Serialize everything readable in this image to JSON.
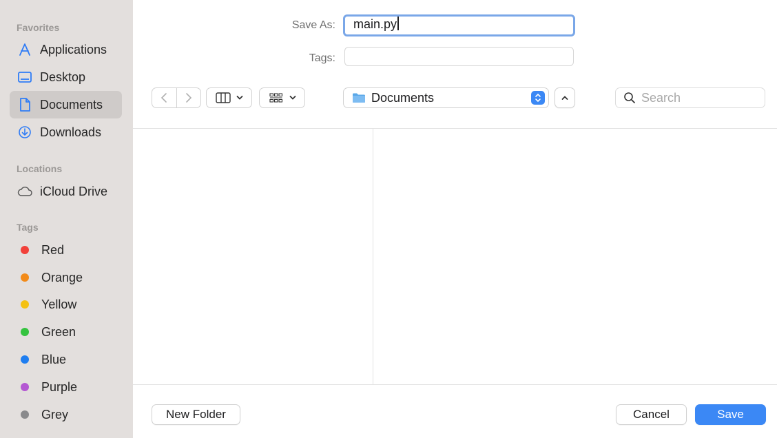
{
  "sidebar": {
    "favorites_header": "Favorites",
    "favorites": [
      {
        "label": "Applications",
        "icon": "applications-icon"
      },
      {
        "label": "Desktop",
        "icon": "desktop-icon"
      },
      {
        "label": "Documents",
        "icon": "document-icon",
        "selected": true
      },
      {
        "label": "Downloads",
        "icon": "downloads-icon"
      }
    ],
    "locations_header": "Locations",
    "locations": [
      {
        "label": "iCloud Drive",
        "icon": "cloud-icon"
      }
    ],
    "tags_header": "Tags",
    "tags": [
      {
        "label": "Red",
        "color": "#f2413a"
      },
      {
        "label": "Orange",
        "color": "#f28a18"
      },
      {
        "label": "Yellow",
        "color": "#f4c112"
      },
      {
        "label": "Green",
        "color": "#35c33f"
      },
      {
        "label": "Blue",
        "color": "#1f7ef0"
      },
      {
        "label": "Purple",
        "color": "#b458d2"
      },
      {
        "label": "Grey",
        "color": "#8a8a8c"
      }
    ]
  },
  "form": {
    "save_as_label": "Save As:",
    "save_as_value": "main.py",
    "tags_label": "Tags:",
    "tags_value": ""
  },
  "toolbar": {
    "location": "Documents",
    "search_placeholder": "Search"
  },
  "footer": {
    "new_folder": "New Folder",
    "cancel": "Cancel",
    "save": "Save"
  },
  "colors": {
    "accent": "#3b88f5",
    "sidebar_bg": "#e3dfdd",
    "selected_bg": "#cfcbc9"
  }
}
